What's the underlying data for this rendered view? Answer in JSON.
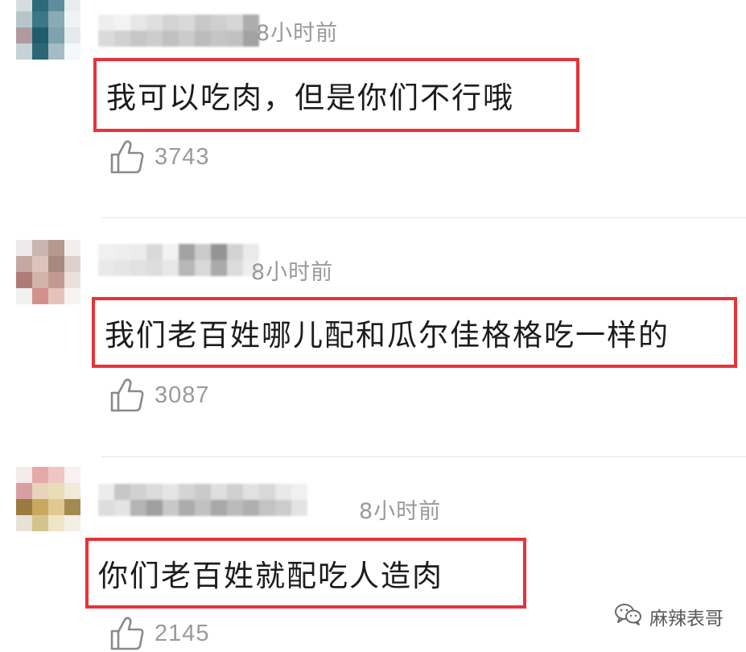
{
  "comments": [
    {
      "time": "8小时前",
      "text": "我可以吃肉，但是你们不行哦",
      "likes": "3743",
      "avatar_colors": [
        "#d6dde0",
        "#2a6a7a",
        "#5e8e9c",
        "#e8eef0",
        "#b8c6cc",
        "#3a7888",
        "#8aaab4",
        "#f0f3f4",
        "#b09aa0",
        "#1f5c6c",
        "#7ea2ae",
        "#e4eaed",
        "#c7d2d6",
        "#2d6676",
        "#a6bcc4",
        "#f5f7f8"
      ],
      "username_colors": [
        "#eeeeee",
        "#d9d9d9",
        "#f3f3f3",
        "#cfcfcf",
        "#e6e6e6",
        "#c4c4c4",
        "#dedede",
        "#cacaca",
        "#d2d2d2",
        "#bdbdbd",
        "#d8d8d8",
        "#c9c9c9",
        "#c6c6c6",
        "#b9b9b9",
        "#cdcdcd",
        "#c2c2c2",
        "#d4d4d4",
        "#bebebe",
        "#a9a9a9",
        "#9e9e9e"
      ]
    },
    {
      "time": "8小时前",
      "text": "我们老百姓哪儿配和瓜尔佳格格吃一样的",
      "likes": "3087",
      "avatar_colors": [
        "#eceaea",
        "#c8b6b0",
        "#b59a90",
        "#f3eeec",
        "#c4a8a2",
        "#dcc4bc",
        "#a88880",
        "#e0d0cb",
        "#b07a78",
        "#d2b4ac",
        "#c29a92",
        "#ece0dc",
        "#f0f0f0",
        "#d4908c",
        "#e6c2bc",
        "#f7f3f2"
      ],
      "username_colors": [
        "#f0f0f0",
        "#e8e8e8",
        "#eeeeee",
        "#e4e4e4",
        "#ebebeb",
        "#e0e0e0",
        "#d8d8d8",
        "#dcdcdc",
        "#f2f2f2",
        "#e6e6e6",
        "#9e9e9e",
        "#b4b4b4",
        "#c9c9c9",
        "#d6d6d6",
        "#8f8f8f",
        "#a6a6a6",
        "#d0d0d0",
        "#dadada",
        "#e9e9e9",
        "#eeeeee"
      ]
    },
    {
      "time": "8小时前",
      "text": "你们老百姓就配吃人造肉",
      "likes": "2145",
      "avatar_colors": [
        "#f4eaea",
        "#e6a8a8",
        "#eec6c4",
        "#f7f2f0",
        "#d8a0a0",
        "#e8d4b8",
        "#e9dcb8",
        "#f0ead8",
        "#9c7a40",
        "#c9a860",
        "#e0c890",
        "#a48a50",
        "#e8e2d6",
        "#d4c48c",
        "#efe4c4",
        "#f3efe6"
      ],
      "username_colors": [
        "#ececec",
        "#dcdcdc",
        "#c4c4c4",
        "#e2e2e2",
        "#cfcfcf",
        "#b0b0b0",
        "#dadada",
        "#9a9a9a",
        "#e4e4e4",
        "#c6c6c6",
        "#d2d2d2",
        "#a8a8a8",
        "#c8c8c8",
        "#bdbdbd",
        "#dedede",
        "#a4a4a4",
        "#cecece",
        "#b8b8b8",
        "#e0e0e0",
        "#ababab",
        "#d6d6d6",
        "#c0c0c0",
        "#e8e8e8",
        "#cacaca",
        "#f0f0f0",
        "#e2e2e2"
      ]
    }
  ],
  "watermark": {
    "text": "麻辣表哥",
    "icon": "wechat-icon"
  },
  "colors": {
    "highlight_border": "#e8323a",
    "meta_text": "#9a9a9a",
    "divider": "#e6e6e6"
  }
}
